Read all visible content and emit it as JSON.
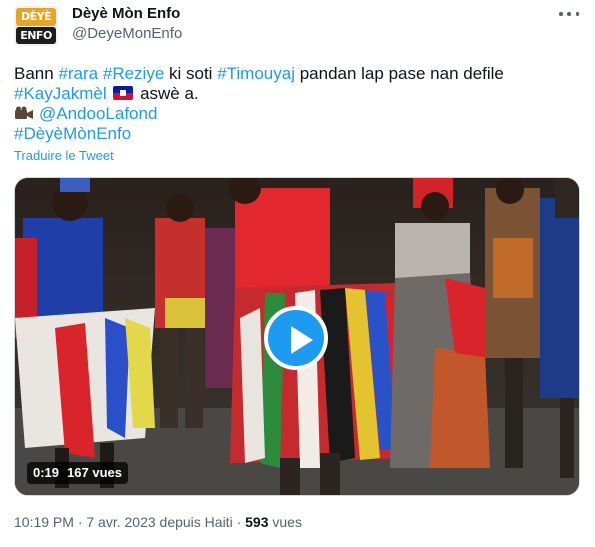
{
  "author": {
    "logo_top": "DÈYÈ MÒN",
    "logo_bottom": "ENFO",
    "display_name": "Dèyè Mòn Enfo",
    "handle": "@DeyeMonEnfo"
  },
  "more_icon": "more-horizontal-icon",
  "tweet": {
    "t1": "Bann ",
    "tag_rara": "#rara",
    "t2": " ",
    "tag_reziye": "#Reziye",
    "t3": " ki soti ",
    "tag_timouyaj": "#Timouyaj",
    "t4": " pandan lap pase nan defile",
    "tag_kayjakmel": "#KayJakmèl",
    "flag": "haiti-flag-icon",
    "t5": " aswè a.",
    "camera": "video-camera-icon",
    "mention": "@AndooLafond",
    "tag_deyemonenfo": "#DèyèMònEnfo"
  },
  "translate_label": "Traduire le Tweet",
  "video": {
    "play_icon": "play-icon",
    "duration": "0:19",
    "views": "167 vues"
  },
  "meta": {
    "timestamp": "10:19 PM · 7 avr. 2023 depuis Haiti · ",
    "views_count": "593",
    "views_label": " vues"
  },
  "colors": {
    "link": "#1d9bf0",
    "secondary": "#536471",
    "text": "#0f1419"
  }
}
